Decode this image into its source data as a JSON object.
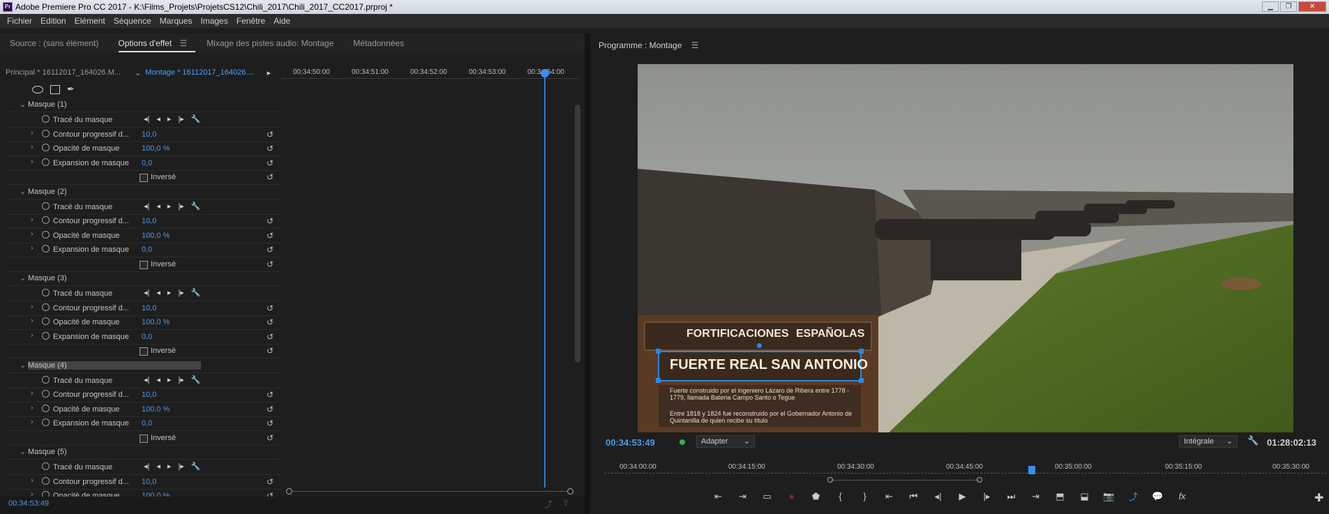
{
  "window": {
    "title": "Adobe Premiere Pro CC 2017 - K:\\Films_Projets\\ProjetsCS12\\Chili_2017\\Chili_2017_CC2017.prproj *",
    "icon_label": "Pr",
    "minimize": "▁",
    "restore": "❐",
    "close": "✕"
  },
  "menu": [
    "Fichier",
    "Edition",
    "Elément",
    "Séquence",
    "Marques",
    "Images",
    "Fenêtre",
    "Aide"
  ],
  "left_tabs": {
    "source": "Source : (sans élément)",
    "effects": "Options d'effet",
    "mixer": "Mixage des pistes audio: Montage",
    "metadata": "Métadonnées"
  },
  "seq": {
    "principal": "Principal * 16112017_164026.M...",
    "montage": "Montage * 16112017_164026...."
  },
  "ruler": [
    "00:34:50:00",
    "00:34:51:00",
    "00:34:52:00",
    "00:34:53:00",
    "00:34:54:00"
  ],
  "masks": [
    {
      "name": "Masque (1)",
      "path": "Tracé du masque",
      "feather": "Contour progressif d...",
      "feather_val": "10,0",
      "opacity": "Opacité de masque",
      "opacity_val": "100,0 %",
      "expansion": "Expansion de masque",
      "expansion_val": "0,0",
      "inverted": "Inversé"
    },
    {
      "name": "Masque (2)",
      "path": "Tracé du masque",
      "feather": "Contour progressif d...",
      "feather_val": "10,0",
      "opacity": "Opacité de masque",
      "opacity_val": "100,0 %",
      "expansion": "Expansion de masque",
      "expansion_val": "0,0",
      "inverted": "Inversé"
    },
    {
      "name": "Masque (3)",
      "path": "Tracé du masque",
      "feather": "Contour progressif d...",
      "feather_val": "10,0",
      "opacity": "Opacité de masque",
      "opacity_val": "100,0 %",
      "expansion": "Expansion de masque",
      "expansion_val": "0,0",
      "inverted": "Inversé"
    },
    {
      "name": "Masque (4)",
      "path": "Tracé du masque",
      "feather": "Contour progressif d...",
      "feather_val": "10,0",
      "opacity": "Opacité de masque",
      "opacity_val": "100,0 %",
      "expansion": "Expansion de masque",
      "expansion_val": "0,0",
      "inverted": "Inversé"
    },
    {
      "name": "Masque (5)",
      "path": "Tracé du masque",
      "feather": "Contour progressif d...",
      "feather_val": "10,0",
      "opacity": "Opacité de masque",
      "opacity_val": "100,0 %"
    }
  ],
  "left_status": {
    "timecode": "00:34:53:49"
  },
  "program": {
    "tab": "Programme : Montage",
    "current_tc": "00:34:53:49",
    "fit": "Adapter",
    "quality": "Intégrale",
    "duration": "01:28:02:13"
  },
  "program_ruler": [
    "00:34:00:00",
    "00:34:15:00",
    "00:34:30:00",
    "00:34:45:00",
    "00:35:00:00",
    "00:35:15:00",
    "00:35:30:00"
  ],
  "sign": {
    "header_left": "FORTIFICACIONES",
    "header_right": "ESPAÑOLAS",
    "title": "FUERTE REAL SAN ANTONIO",
    "text1": "Fuerte construido por el ingeniero Lázaro de Ribera entre 1778 - 1779, llamada Bateria Campo Santo o Tegue",
    "text2": "Entre 1818 y 1824 fue reconstruido por el Gobernador Antonio de Quintanilla de quien recibe su título"
  },
  "colors": {
    "accent": "#4a9cf0",
    "panel": "#1e1e1e",
    "record": "#35b04b"
  }
}
